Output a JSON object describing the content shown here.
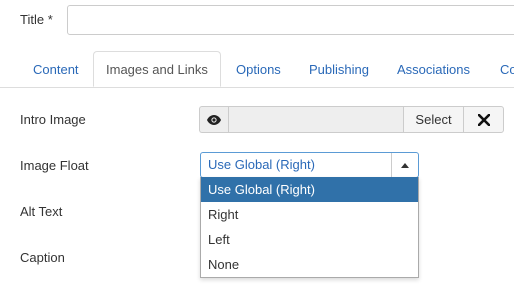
{
  "fields": {
    "title_label": "Title *",
    "title_value": "",
    "intro_image_label": "Intro Image",
    "image_float_label": "Image Float",
    "alt_text_label": "Alt Text",
    "caption_label": "Caption"
  },
  "tabs": [
    {
      "label": "Content",
      "active": false
    },
    {
      "label": "Images and Links",
      "active": true
    },
    {
      "label": "Options",
      "active": false
    },
    {
      "label": "Publishing",
      "active": false
    },
    {
      "label": "Associations",
      "active": false
    },
    {
      "label": "Co",
      "active": false
    }
  ],
  "intro_image": {
    "preview_icon": "eye-icon",
    "value": "",
    "select_label": "Select",
    "clear_icon": "close-icon"
  },
  "image_float": {
    "selected": "Use Global (Right)",
    "options": [
      "Use Global (Right)",
      "Right",
      "Left",
      "None"
    ],
    "arrow_icon": "caret-up-icon"
  },
  "colors": {
    "link": "#2a69b8",
    "selected_option_bg": "#3071a9",
    "focus_border": "#5b9bd5"
  }
}
